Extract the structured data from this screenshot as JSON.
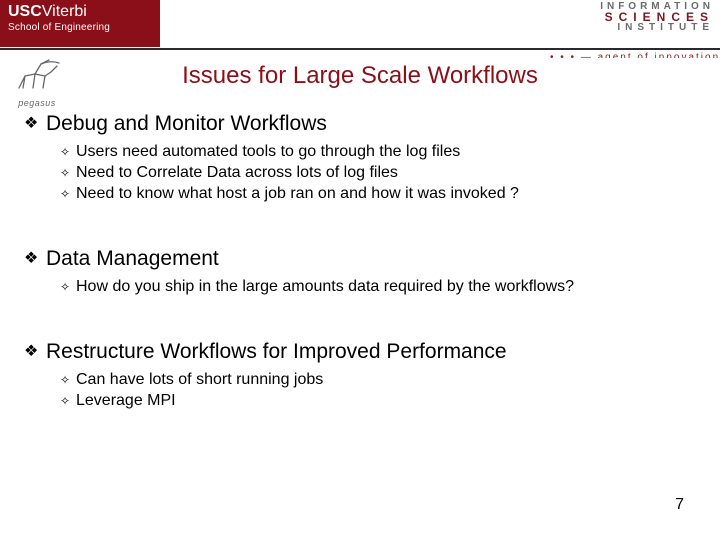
{
  "brand": {
    "usc_bold": "USC",
    "usc_light": "Viterbi",
    "school": "School of Engineering",
    "isi_line1": "INFORMATION",
    "isi_line2": "SCIENCES",
    "isi_line3": "INSTITUTE",
    "dots": "• • •   — agent of  innovation  • •  •",
    "pegasus_label": "pegasus"
  },
  "title": "Issues for Large Scale Workflows",
  "sections": [
    {
      "heading": "Debug and Monitor Workflows",
      "items": [
        "Users need automated tools to go through the log files",
        "Need to Correlate Data across lots of log files",
        "Need to know what host a job ran on and how it was invoked ?"
      ]
    },
    {
      "heading": "Data Management",
      "items": [
        "How do you ship in the large amounts data required by the workflows?"
      ]
    },
    {
      "heading": " Restructure Workflows for Improved Performance",
      "items": [
        "Can have lots of short running jobs",
        "Leverage MPI"
      ]
    }
  ],
  "page_number": "7",
  "bullet_marks": {
    "l1": "❖",
    "l2": "✧"
  }
}
